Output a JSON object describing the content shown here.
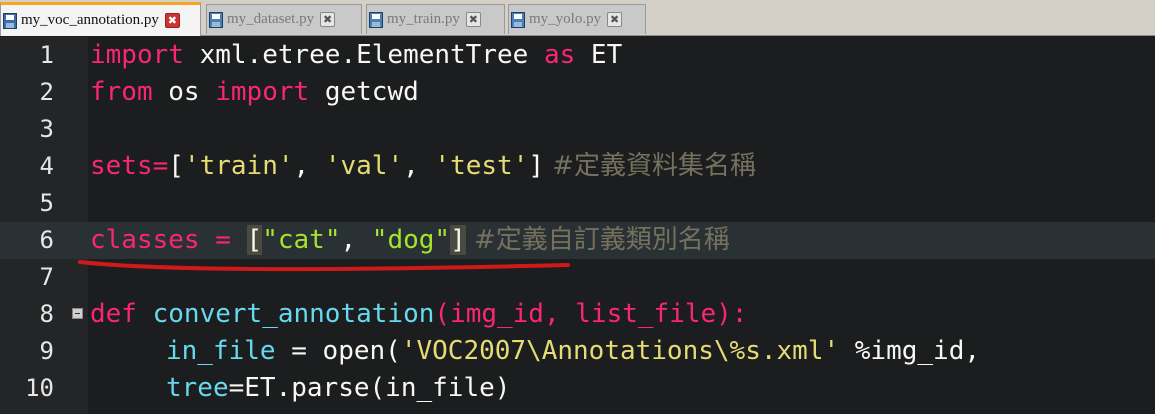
{
  "tabs": [
    {
      "label": "my_voc_annotation.py",
      "active": true
    },
    {
      "label": "my_dataset.py",
      "active": false
    },
    {
      "label": "my_train.py",
      "active": false
    },
    {
      "label": "my_yolo.py",
      "active": false
    }
  ],
  "close_glyph": "✖",
  "lines": [
    {
      "num": "1"
    },
    {
      "num": "2"
    },
    {
      "num": "3"
    },
    {
      "num": "4"
    },
    {
      "num": "5"
    },
    {
      "num": "6"
    },
    {
      "num": "7"
    },
    {
      "num": "8"
    },
    {
      "num": "9"
    },
    {
      "num": "10"
    }
  ],
  "code": {
    "l1": {
      "import": "import",
      "mod": " xml.etree.ElementTree ",
      "as": "as",
      "alias": " ET"
    },
    "l2": {
      "from": "from",
      "mod": " os ",
      "import": "import",
      "name": " getcwd"
    },
    "l4": {
      "var": "sets",
      "eq": "=",
      "open": "[",
      "s1": "'train'",
      "c1": ", ",
      "s2": "'val'",
      "c2": ", ",
      "s3": "'test'",
      "close": "]",
      "comment": " #定義資料集名稱"
    },
    "l6": {
      "var": "classes",
      "eq": " = ",
      "open": "[",
      "s1": "\"cat\"",
      "c1": ", ",
      "s2": "\"dog\"",
      "close": "]",
      "comment": " #定義自訂義類別名稱"
    },
    "l8": {
      "def": "def",
      "fname": " convert_annotation",
      "args": "(img_id, list_file):"
    },
    "l9": {
      "var": "in_file",
      "eq": " = ",
      "fn": "open",
      "open": "(",
      "s": "'VOC2007\\Annotations\\%s.xml'",
      "op": " %img_id,"
    },
    "l10": {
      "var": "tree",
      "eq": "=",
      "obj": "ET",
      "dot": ".",
      "fn": "parse",
      "args": "(in_file)"
    }
  },
  "colors": {
    "accent_tab": "#f5a623",
    "annotation": "#d01a1a",
    "current_line": "#293134"
  }
}
